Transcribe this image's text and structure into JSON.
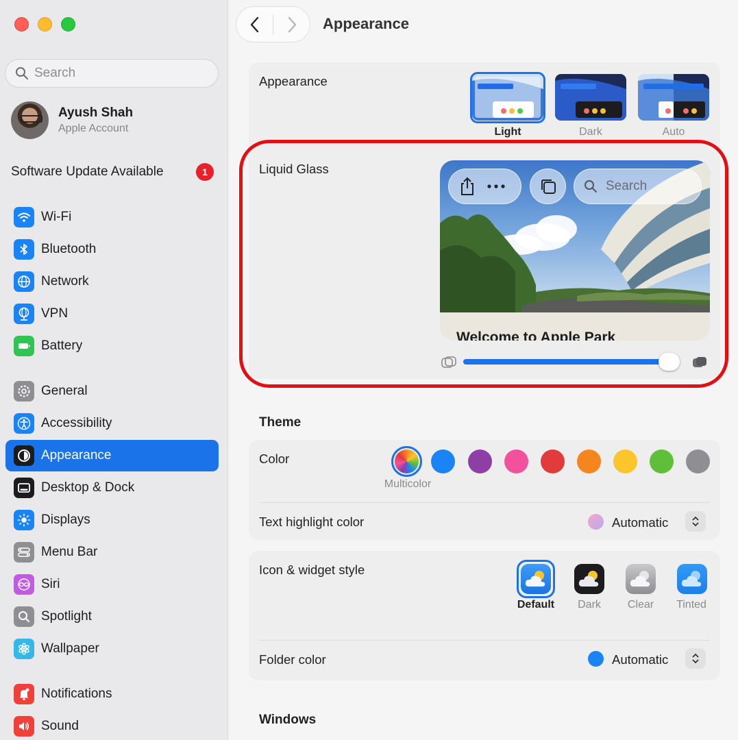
{
  "sidebar": {
    "search_placeholder": "Search",
    "account": {
      "name": "Ayush Shah",
      "subtitle": "Apple Account"
    },
    "software_update": {
      "label": "Software Update Available",
      "count": "1"
    },
    "items": [
      {
        "label": "Wi-Fi",
        "icon": "wifi-icon",
        "color": "#1a84f5"
      },
      {
        "label": "Bluetooth",
        "icon": "bluetooth-icon",
        "color": "#1a84f5"
      },
      {
        "label": "Network",
        "icon": "globe-icon",
        "color": "#1a84f5"
      },
      {
        "label": "VPN",
        "icon": "vpn-globe-icon",
        "color": "#1a84f5"
      },
      {
        "label": "Battery",
        "icon": "battery-icon",
        "color": "#30c551"
      },
      {
        "label": "General",
        "icon": "gear-icon",
        "color": "#8e8e93"
      },
      {
        "label": "Accessibility",
        "icon": "accessibility-icon",
        "color": "#1a84f5"
      },
      {
        "label": "Appearance",
        "icon": "appearance-icon",
        "color": "#1c1c1e"
      },
      {
        "label": "Desktop & Dock",
        "icon": "dock-icon",
        "color": "#1c1c1e"
      },
      {
        "label": "Displays",
        "icon": "sun-icon",
        "color": "#1a84f5"
      },
      {
        "label": "Menu Bar",
        "icon": "menubar-icon",
        "color": "#8e8e93"
      },
      {
        "label": "Siri",
        "icon": "siri-icon",
        "color": "#c05ce0"
      },
      {
        "label": "Spotlight",
        "icon": "magnifier-icon",
        "color": "#8e8e93"
      },
      {
        "label": "Wallpaper",
        "icon": "flower-icon",
        "color": "#35b8e8"
      },
      {
        "label": "Notifications",
        "icon": "bell-icon",
        "color": "#f0403a"
      },
      {
        "label": "Sound",
        "icon": "speaker-icon",
        "color": "#f0403a"
      }
    ]
  },
  "main": {
    "title": "Appearance",
    "appearance": {
      "label": "Appearance",
      "options": [
        "Light",
        "Dark",
        "Auto"
      ],
      "selected": "Light"
    },
    "liquid_glass": {
      "label": "Liquid Glass",
      "preview_search": "Search",
      "preview_caption": "Welcome to Apple Park",
      "slider_fraction": 0.97
    },
    "theme": {
      "heading": "Theme",
      "color_label": "Color",
      "selected_color_name": "Multicolor",
      "colors": [
        "multicolor",
        "#1a84f5",
        "#8e3fa6",
        "#f2529d",
        "#e13b3b",
        "#f5851f",
        "#fcc52b",
        "#5fbf3a",
        "#8e8e93"
      ],
      "text_highlight_label": "Text highlight color",
      "text_highlight_value": "Automatic"
    },
    "icon_widget": {
      "label": "Icon & widget style",
      "options": [
        "Default",
        "Dark",
        "Clear",
        "Tinted"
      ],
      "selected": "Default",
      "folder_label": "Folder color",
      "folder_value": "Automatic"
    },
    "windows": {
      "heading": "Windows"
    }
  }
}
